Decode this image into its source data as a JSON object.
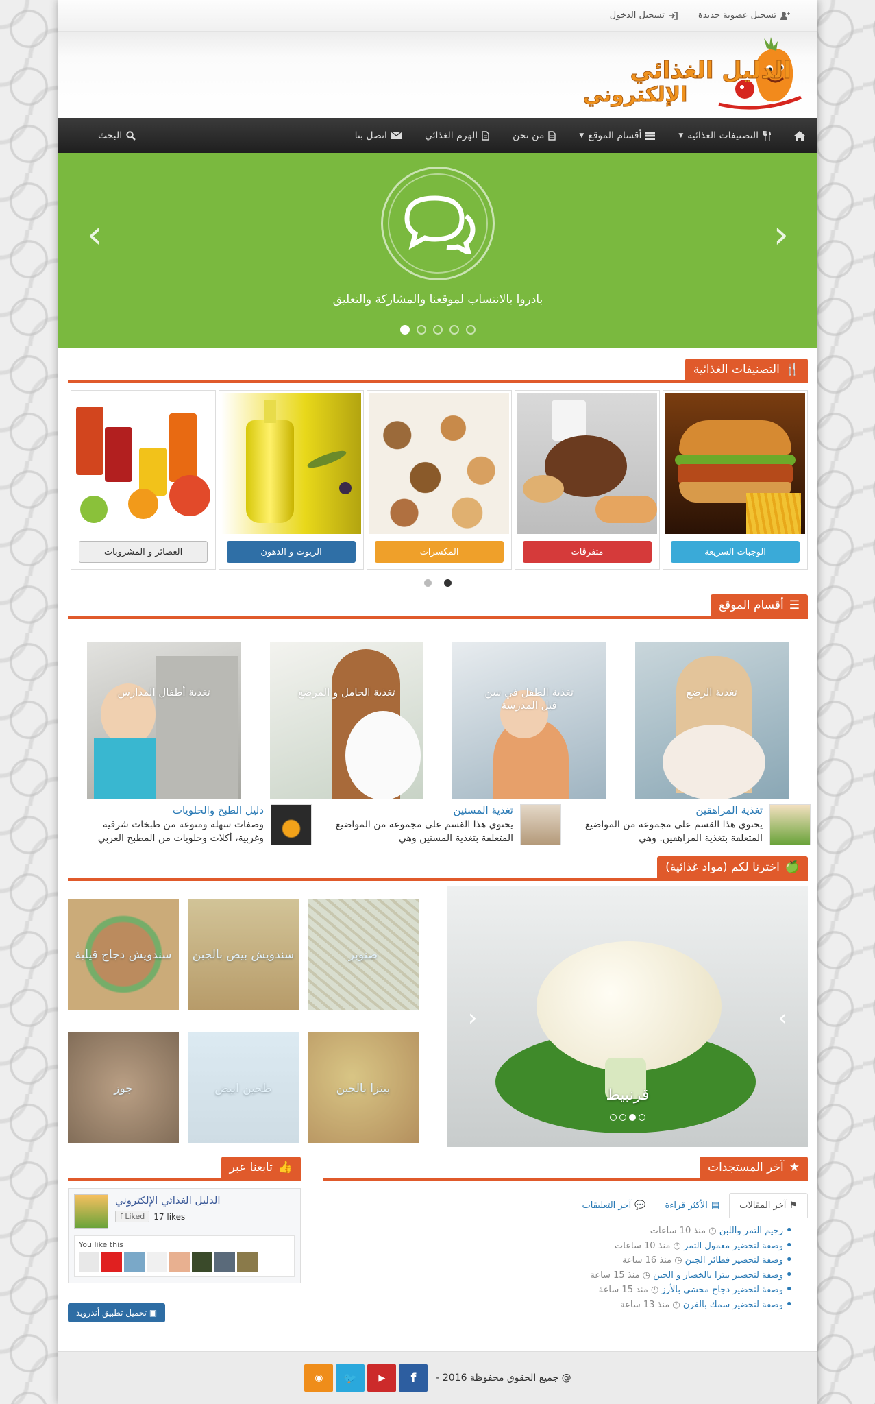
{
  "top_bar": {
    "register": "تسجيل عضوية جديدة",
    "login": "تسجيل الدخول"
  },
  "nav": {
    "items": [
      {
        "label": "التصنيفات الغذائية",
        "dropdown": true
      },
      {
        "label": "أقسام الموقع",
        "dropdown": true
      },
      {
        "label": "من نحن",
        "dropdown": false
      },
      {
        "label": "الهرم الغذائي",
        "dropdown": false
      },
      {
        "label": "اتصل بنا",
        "dropdown": false
      }
    ],
    "search": "البحث"
  },
  "hero": {
    "caption": "بادروا بالانتساب لموقعنا والمشاركة والتعليق",
    "slide_count": 5,
    "active_slide": 1
  },
  "categories": {
    "title": "التصنيفات الغذائية",
    "items": [
      {
        "label": "الوجبات السريعة",
        "color": "#3aaad8"
      },
      {
        "label": "متفرقات",
        "color": "#d53a3a"
      },
      {
        "label": "المكسرات",
        "color": "#efa02a"
      },
      {
        "label": "الزيوت و الدهون",
        "color": "#2f6fa6"
      },
      {
        "label": "العصائر و المشروبات",
        "color": "#eeeeee"
      }
    ],
    "page_count": 2,
    "active_page": 1
  },
  "sections": {
    "title": "أقسام الموقع",
    "tiles": [
      {
        "label": "تغذية الرضع"
      },
      {
        "label": "تغذية الطفل في سن قبل المدرسة"
      },
      {
        "label": "تغذية الحامل و المرضع"
      },
      {
        "label": "تغذية أطفال المدارس"
      }
    ],
    "articles": [
      {
        "title": "تغذية المراهقين",
        "text": "يحتوي هذا القسم على مجموعة من المواضيع المتعلقة بتغذية المراهقين. وهي"
      },
      {
        "title": "تغذية المسنين",
        "text": "يحتوي هذا القسم على مجموعة من المواضيع المتعلقة بتغذية المسنين وهي"
      },
      {
        "title": "دليل الطبخ والحلويات",
        "text": "وصفات سهلة ومنوعة من طبخات شرقية وغربية، أكلات وحلويات من المطبخ العربي"
      }
    ]
  },
  "picks": {
    "title": "اخترنا لكم (مواد غذائية)",
    "slide_caption": "قرنبيط",
    "slide_count": 4,
    "active_slide": 3,
    "tiles": [
      {
        "label": "صنوبر"
      },
      {
        "label": "سندويش بيض بالجبن"
      },
      {
        "label": "سندويش دجاج قيلية"
      },
      {
        "label": "بيتزا بالجبن"
      },
      {
        "label": "طحين ابيض"
      },
      {
        "label": "جوز"
      }
    ]
  },
  "latest": {
    "title": "آخر المستجدات",
    "tabs": [
      "آخر المقالات",
      "الأكثر قراءة",
      "آخر التعليقات"
    ],
    "active_tab": 0,
    "items": [
      {
        "title": "رجيم التمر واللبن",
        "time": "منذ 10 ساعات"
      },
      {
        "title": "وصفة لتحضير معمول التمر",
        "time": "منذ 10 ساعات"
      },
      {
        "title": "وصفة لتحضير فطائر الجبن",
        "time": "منذ 16 ساعة"
      },
      {
        "title": "وصفة لتحضير بيتزا بالخضار و الجبن",
        "time": "منذ 15 ساعة"
      },
      {
        "title": "وصفة لتحضير دجاج محشي بالأرز",
        "time": "منذ 15 ساعة"
      },
      {
        "title": "وصفة لتحضير سمك بالفرن",
        "time": "منذ 13 ساعة"
      }
    ]
  },
  "follow": {
    "title": "تابعنا عبر",
    "fb_page": "الدليل الغذائي الإلكتروني",
    "liked": "Liked",
    "likes": "17 likes",
    "you_like": "You like this",
    "android_button": "تحميل تطبيق أندرويد"
  },
  "footer": {
    "copyright": "@ جميع الحقوق محفوظة 2016 -"
  },
  "colors": {
    "accent": "#e05a2b",
    "green": "#7ab93f",
    "link": "#2a7ab5",
    "nav": "#2b2b2b"
  }
}
